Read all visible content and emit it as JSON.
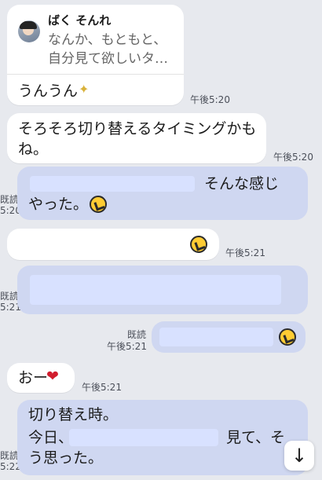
{
  "messages": [
    {
      "reply": {
        "sender": "ばく そんれ",
        "snippet_line1": "なんか、もともと、",
        "snippet_line2": "自分見て欲しいタ…"
      },
      "text": "うんうん",
      "time": "午後5:20"
    },
    {
      "line1": "そろそろ切り替えるタイミングかも",
      "line2": "ね。",
      "time": "午後5:20"
    },
    {
      "read": "既読",
      "time": "5:20",
      "text_right": "そんな感じ",
      "line2": "やった。"
    },
    {
      "time": "午後5:21"
    },
    {
      "read": "既読",
      "time": "5:21"
    },
    {
      "read": "既読",
      "time": "午後5:21"
    },
    {
      "text": "おー",
      "time": "午後5:21"
    },
    {
      "read": "既読",
      "time": "5:22",
      "line1": "切り替え時。",
      "line2_start": "今日、",
      "line2_end": "見て、そ",
      "line3": "う思った。"
    }
  ],
  "icons": {
    "scroll": "arrow-down-icon",
    "emoji": "laughing-emoji-icon",
    "sparkle": "sparkles-icon",
    "heart": "heart-icon"
  },
  "colors": {
    "background": "#e7e9ee",
    "incoming": "#ffffff",
    "outgoing": "#cfd7f1",
    "redaction": "#d8e1ff"
  }
}
